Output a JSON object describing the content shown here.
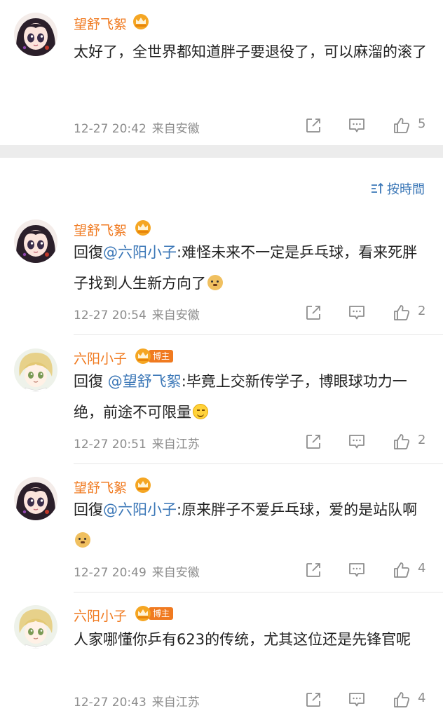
{
  "sort_label": "按時間",
  "host_badge": "博主",
  "top_comment": {
    "user": "望舒飞絮",
    "text": "太好了，全世界都知道胖子要退役了，可以麻溜的滚了",
    "time": "12-27 20:42",
    "location": "来自安徽",
    "likes": "5"
  },
  "replies": [
    {
      "user": "望舒飞絮",
      "prefix": "回復",
      "mention": "@六阳小子",
      "text": ":难怪未来不一定是乒乓球，看来死胖子找到人生新方向了",
      "emoji": "doge-emoji",
      "time": "12-27 20:54",
      "location": "来自安徽",
      "likes": "2"
    },
    {
      "user": "六阳小子",
      "is_host": true,
      "prefix": "回復 ",
      "mention": "@望舒飞絮",
      "text": ":毕竟上交新传学子，博眼球功力一绝，前途不可限量",
      "emoji": "smile-emoji",
      "time": "12-27 20:51",
      "location": "来自江苏",
      "likes": "2"
    },
    {
      "user": "望舒飞絮",
      "prefix": "回復",
      "mention": "@六阳小子",
      "text": ":原来胖子不爱乒乓球，爱的是站队啊",
      "emoji": "doge-emoji",
      "time": "12-27 20:49",
      "location": "来自安徽",
      "likes": "4"
    },
    {
      "user": "六阳小子",
      "is_host": true,
      "text": "人家哪懂你乒有623的传统，尤其这位还是先锋官呢",
      "time": "12-27 20:43",
      "location": "来自江苏",
      "likes": "4"
    }
  ],
  "icons": [
    "edit-icon",
    "comment-icon",
    "like-icon",
    "sort-icon",
    "vip-crown-icon"
  ],
  "colors": {
    "username": "#f07a20",
    "mention": "#3b77b7",
    "meta": "#8d8d8d",
    "separator": "#ececec"
  }
}
